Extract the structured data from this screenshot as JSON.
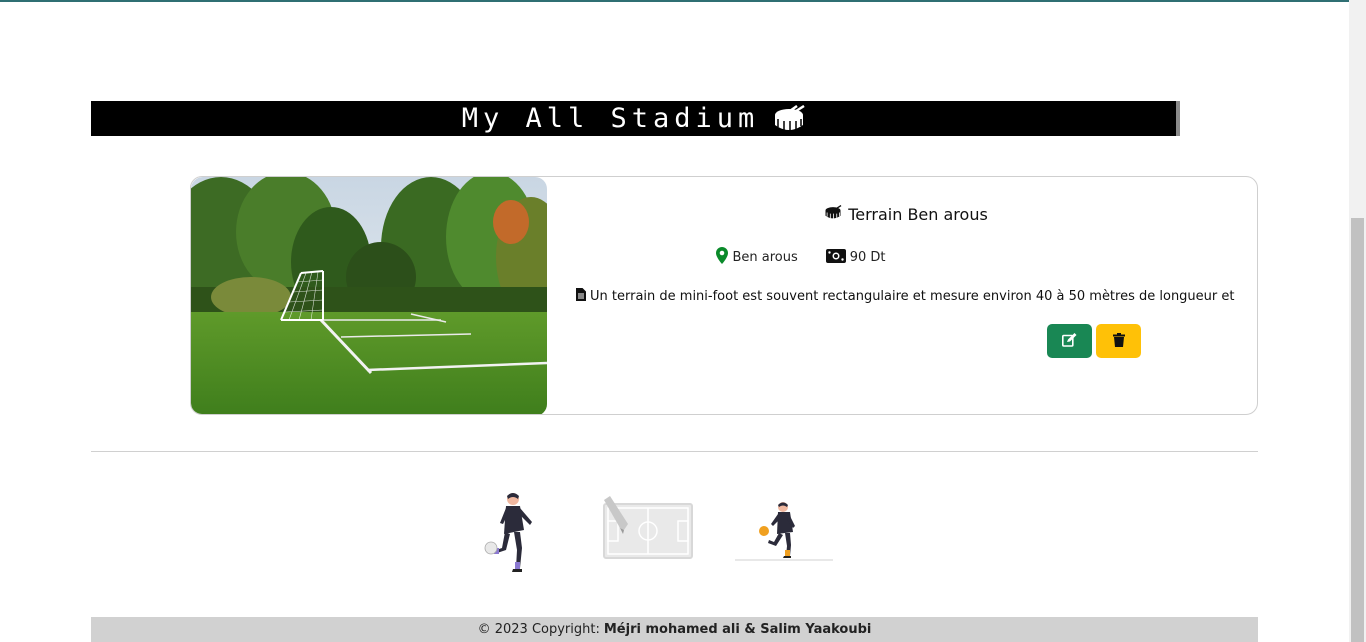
{
  "header": {
    "title": "My All Stadium",
    "icon": "drum-icon"
  },
  "stadium_card": {
    "name": "Terrain Ben arous",
    "location": "Ben arous",
    "price": "90 Dt",
    "description": "Un terrain de mini-foot est souvent rectangulaire et mesure environ 40 à 50 mètres de longueur et 20 ...",
    "edit_icon": "edit-icon",
    "delete_icon": "trash-icon"
  },
  "footer": {
    "prefix": "© 2023 Copyright:",
    "authors": "Méjri mohamed ali & Salim Yaakoubi"
  },
  "colors": {
    "edit_button": "#198754",
    "delete_button": "#ffc107",
    "location_pin": "#0a8a2a"
  }
}
